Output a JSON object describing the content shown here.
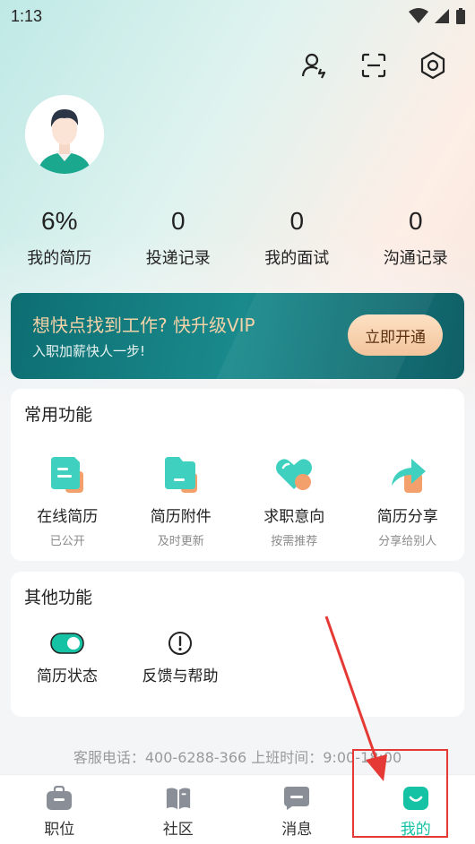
{
  "status_bar": {
    "time": "1:13"
  },
  "header_icons": [
    "user-switch-icon",
    "scan-icon",
    "settings-icon"
  ],
  "stats": [
    {
      "value": "6%",
      "label": "我的简历"
    },
    {
      "value": "0",
      "label": "投递记录"
    },
    {
      "value": "0",
      "label": "我的面试"
    },
    {
      "value": "0",
      "label": "沟通记录"
    }
  ],
  "vip": {
    "title": "想快点找到工作? 快升级VIP",
    "subtitle": "入职加薪快人一步!",
    "button": "立即开通"
  },
  "common_functions": {
    "title": "常用功能",
    "items": [
      {
        "label": "在线简历",
        "sub": "已公开",
        "icon": "online-resume-icon"
      },
      {
        "label": "简历附件",
        "sub": "及时更新",
        "icon": "resume-attachment-icon"
      },
      {
        "label": "求职意向",
        "sub": "按需推荐",
        "icon": "job-intent-icon"
      },
      {
        "label": "简历分享",
        "sub": "分享给别人",
        "icon": "resume-share-icon"
      }
    ]
  },
  "other_functions": {
    "title": "其他功能",
    "items": [
      {
        "label": "简历状态",
        "icon": "toggle-icon"
      },
      {
        "label": "反馈与帮助",
        "icon": "help-icon"
      }
    ]
  },
  "service": {
    "line": "客服电话：400-6288-366   上班时间：9:00-18:00"
  },
  "tabbar": [
    {
      "label": "职位",
      "icon": "briefcase-icon"
    },
    {
      "label": "社区",
      "icon": "book-icon"
    },
    {
      "label": "消息",
      "icon": "message-icon"
    },
    {
      "label": "我的",
      "icon": "profile-icon",
      "active": true
    }
  ],
  "colors": {
    "accent": "#15c3a4",
    "vip_bg": "#0d6e72",
    "vip_text": "#f3d2a8",
    "annotation": "#e53935"
  }
}
